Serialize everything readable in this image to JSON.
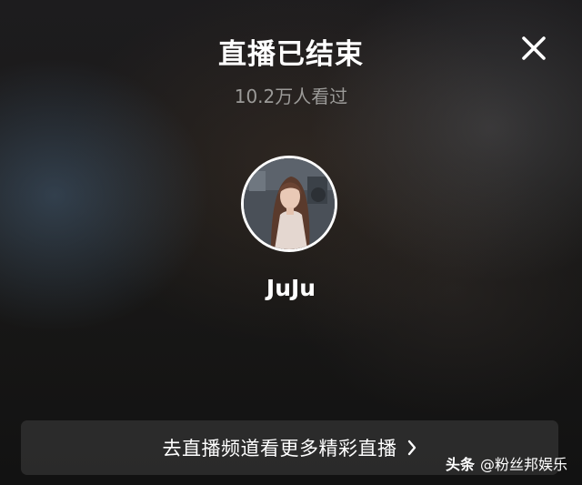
{
  "header": {
    "title": "直播已结束",
    "viewers": "10.2万人看过",
    "close_icon": "close-icon"
  },
  "streamer": {
    "name": "JuJu",
    "avatar_icon": "avatar"
  },
  "channel_button": {
    "label": "去直播频道看更多精彩直播",
    "chevron_icon": "chevron-right-icon"
  },
  "watermark": {
    "brand": "头条",
    "account": "@粉丝邦娱乐"
  },
  "colors": {
    "text_primary": "#ffffff",
    "text_secondary": "#9b9a98",
    "button_bg": "rgba(255,255,255,0.1)"
  }
}
